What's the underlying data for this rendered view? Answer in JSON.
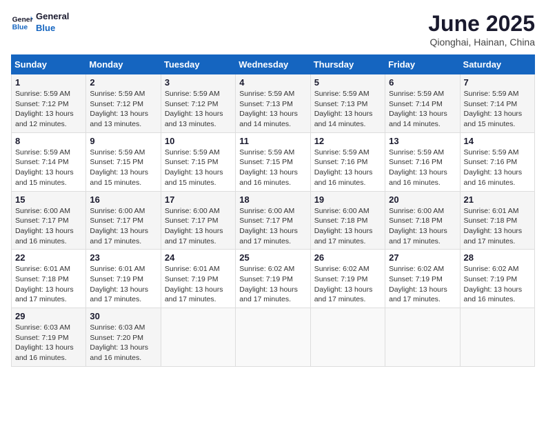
{
  "logo": {
    "line1": "General",
    "line2": "Blue"
  },
  "title": "June 2025",
  "subtitle": "Qionghai, Hainan, China",
  "days_of_week": [
    "Sunday",
    "Monday",
    "Tuesday",
    "Wednesday",
    "Thursday",
    "Friday",
    "Saturday"
  ],
  "weeks": [
    [
      {
        "day": 1,
        "sunrise": "5:59 AM",
        "sunset": "7:12 PM",
        "daylight": "13 hours and 12 minutes."
      },
      {
        "day": 2,
        "sunrise": "5:59 AM",
        "sunset": "7:12 PM",
        "daylight": "13 hours and 13 minutes."
      },
      {
        "day": 3,
        "sunrise": "5:59 AM",
        "sunset": "7:12 PM",
        "daylight": "13 hours and 13 minutes."
      },
      {
        "day": 4,
        "sunrise": "5:59 AM",
        "sunset": "7:13 PM",
        "daylight": "13 hours and 14 minutes."
      },
      {
        "day": 5,
        "sunrise": "5:59 AM",
        "sunset": "7:13 PM",
        "daylight": "13 hours and 14 minutes."
      },
      {
        "day": 6,
        "sunrise": "5:59 AM",
        "sunset": "7:14 PM",
        "daylight": "13 hours and 14 minutes."
      },
      {
        "day": 7,
        "sunrise": "5:59 AM",
        "sunset": "7:14 PM",
        "daylight": "13 hours and 15 minutes."
      }
    ],
    [
      {
        "day": 8,
        "sunrise": "5:59 AM",
        "sunset": "7:14 PM",
        "daylight": "13 hours and 15 minutes."
      },
      {
        "day": 9,
        "sunrise": "5:59 AM",
        "sunset": "7:15 PM",
        "daylight": "13 hours and 15 minutes."
      },
      {
        "day": 10,
        "sunrise": "5:59 AM",
        "sunset": "7:15 PM",
        "daylight": "13 hours and 15 minutes."
      },
      {
        "day": 11,
        "sunrise": "5:59 AM",
        "sunset": "7:15 PM",
        "daylight": "13 hours and 16 minutes."
      },
      {
        "day": 12,
        "sunrise": "5:59 AM",
        "sunset": "7:16 PM",
        "daylight": "13 hours and 16 minutes."
      },
      {
        "day": 13,
        "sunrise": "5:59 AM",
        "sunset": "7:16 PM",
        "daylight": "13 hours and 16 minutes."
      },
      {
        "day": 14,
        "sunrise": "5:59 AM",
        "sunset": "7:16 PM",
        "daylight": "13 hours and 16 minutes."
      }
    ],
    [
      {
        "day": 15,
        "sunrise": "6:00 AM",
        "sunset": "7:17 PM",
        "daylight": "13 hours and 16 minutes."
      },
      {
        "day": 16,
        "sunrise": "6:00 AM",
        "sunset": "7:17 PM",
        "daylight": "13 hours and 17 minutes."
      },
      {
        "day": 17,
        "sunrise": "6:00 AM",
        "sunset": "7:17 PM",
        "daylight": "13 hours and 17 minutes."
      },
      {
        "day": 18,
        "sunrise": "6:00 AM",
        "sunset": "7:17 PM",
        "daylight": "13 hours and 17 minutes."
      },
      {
        "day": 19,
        "sunrise": "6:00 AM",
        "sunset": "7:18 PM",
        "daylight": "13 hours and 17 minutes."
      },
      {
        "day": 20,
        "sunrise": "6:00 AM",
        "sunset": "7:18 PM",
        "daylight": "13 hours and 17 minutes."
      },
      {
        "day": 21,
        "sunrise": "6:01 AM",
        "sunset": "7:18 PM",
        "daylight": "13 hours and 17 minutes."
      }
    ],
    [
      {
        "day": 22,
        "sunrise": "6:01 AM",
        "sunset": "7:18 PM",
        "daylight": "13 hours and 17 minutes."
      },
      {
        "day": 23,
        "sunrise": "6:01 AM",
        "sunset": "7:19 PM",
        "daylight": "13 hours and 17 minutes."
      },
      {
        "day": 24,
        "sunrise": "6:01 AM",
        "sunset": "7:19 PM",
        "daylight": "13 hours and 17 minutes."
      },
      {
        "day": 25,
        "sunrise": "6:02 AM",
        "sunset": "7:19 PM",
        "daylight": "13 hours and 17 minutes."
      },
      {
        "day": 26,
        "sunrise": "6:02 AM",
        "sunset": "7:19 PM",
        "daylight": "13 hours and 17 minutes."
      },
      {
        "day": 27,
        "sunrise": "6:02 AM",
        "sunset": "7:19 PM",
        "daylight": "13 hours and 17 minutes."
      },
      {
        "day": 28,
        "sunrise": "6:02 AM",
        "sunset": "7:19 PM",
        "daylight": "13 hours and 16 minutes."
      }
    ],
    [
      {
        "day": 29,
        "sunrise": "6:03 AM",
        "sunset": "7:19 PM",
        "daylight": "13 hours and 16 minutes."
      },
      {
        "day": 30,
        "sunrise": "6:03 AM",
        "sunset": "7:20 PM",
        "daylight": "13 hours and 16 minutes."
      },
      null,
      null,
      null,
      null,
      null
    ]
  ]
}
